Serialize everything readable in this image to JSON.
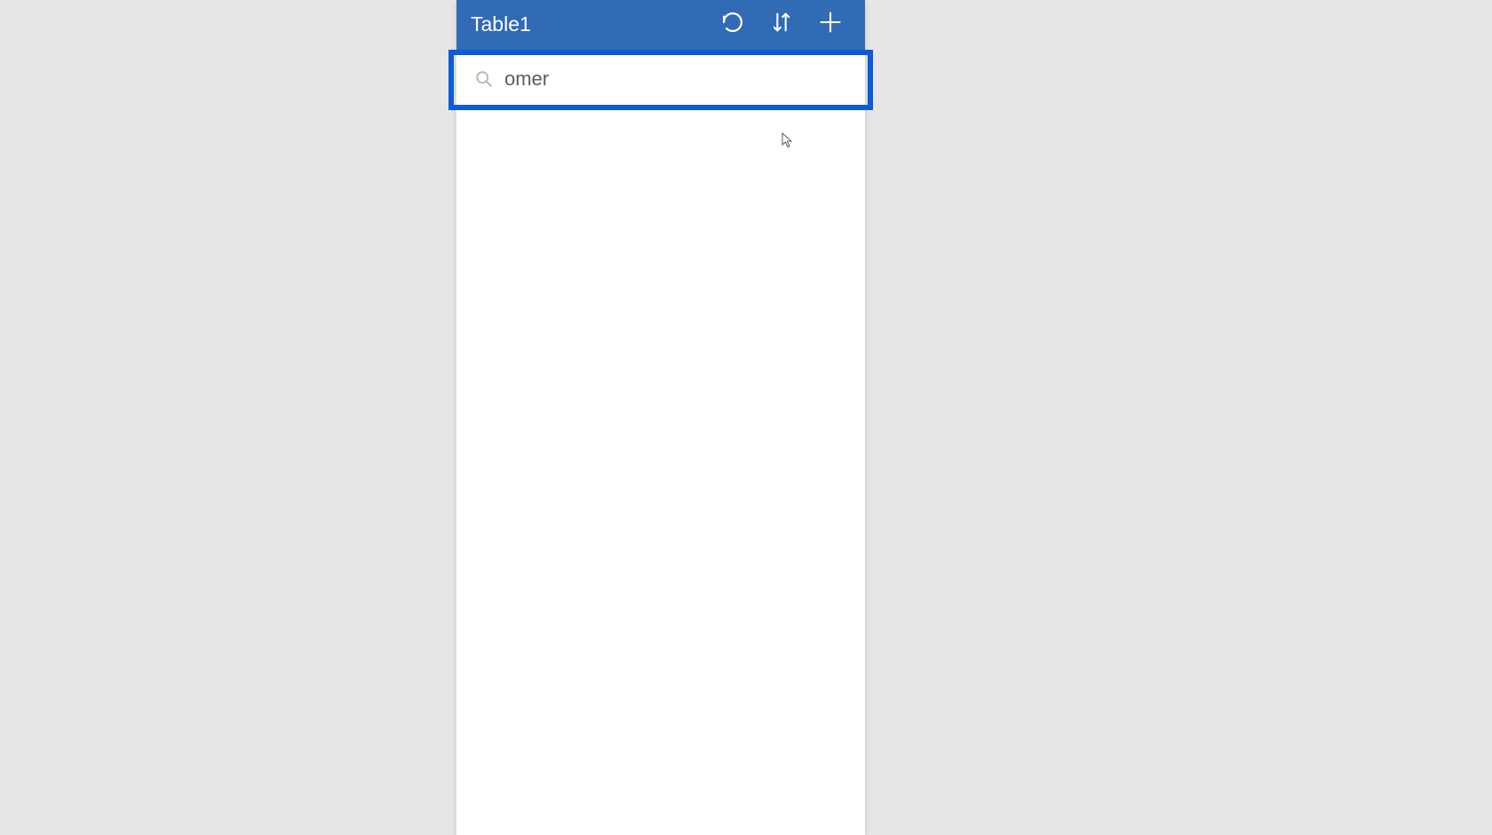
{
  "header": {
    "title": "Table1",
    "icons": {
      "refresh": "refresh-icon",
      "sort": "sort-icon",
      "add": "plus-icon"
    }
  },
  "search": {
    "value": "omer",
    "placeholder": ""
  },
  "colors": {
    "header_bg": "#316bb5",
    "highlight_border": "#0b5cd6",
    "page_bg": "#e6e6e6"
  }
}
